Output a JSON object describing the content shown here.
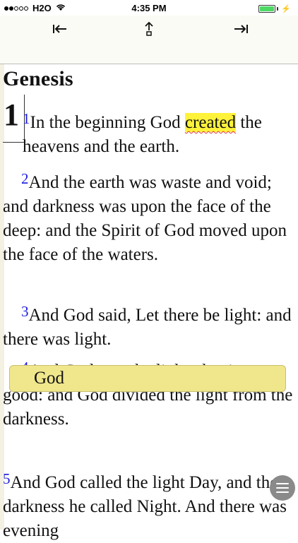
{
  "status_bar": {
    "carrier": "H2O",
    "time": "4:35 PM",
    "signal_dots_filled": 2,
    "signal_dots_total": 5,
    "battery_level": 1.0,
    "battery_color": "#4cd964"
  },
  "toolbar": {
    "prev_icon": "arrow-left-bar-icon",
    "share_icon": "up-arrow-box-icon",
    "next_icon": "arrow-right-bar-icon"
  },
  "book": {
    "title": "Genesis",
    "chapter": "1"
  },
  "verses": [
    {
      "num": "1",
      "before": "In the beginning God ",
      "highlight": "created",
      "after": " the heavens and the earth."
    },
    {
      "num": "2",
      "text": "And the earth was waste and void; and darkness was upon the face of the deep: and the Spirit of God moved upon the face of the waters."
    },
    {
      "num": "3",
      "text": "And God said, Let there be light: and there was light."
    },
    {
      "num": "4",
      "text": "And God saw the light, that it was good: and God divided the light from the darkness."
    },
    {
      "num": "5",
      "text": "And God called the light Day, and the darkness he called Night. And there was evening"
    }
  ],
  "note_box": {
    "label": "God",
    "color": "#f0e68c"
  },
  "highlight_color": "#fff23a",
  "verse_number_color": "#1a1ae0"
}
